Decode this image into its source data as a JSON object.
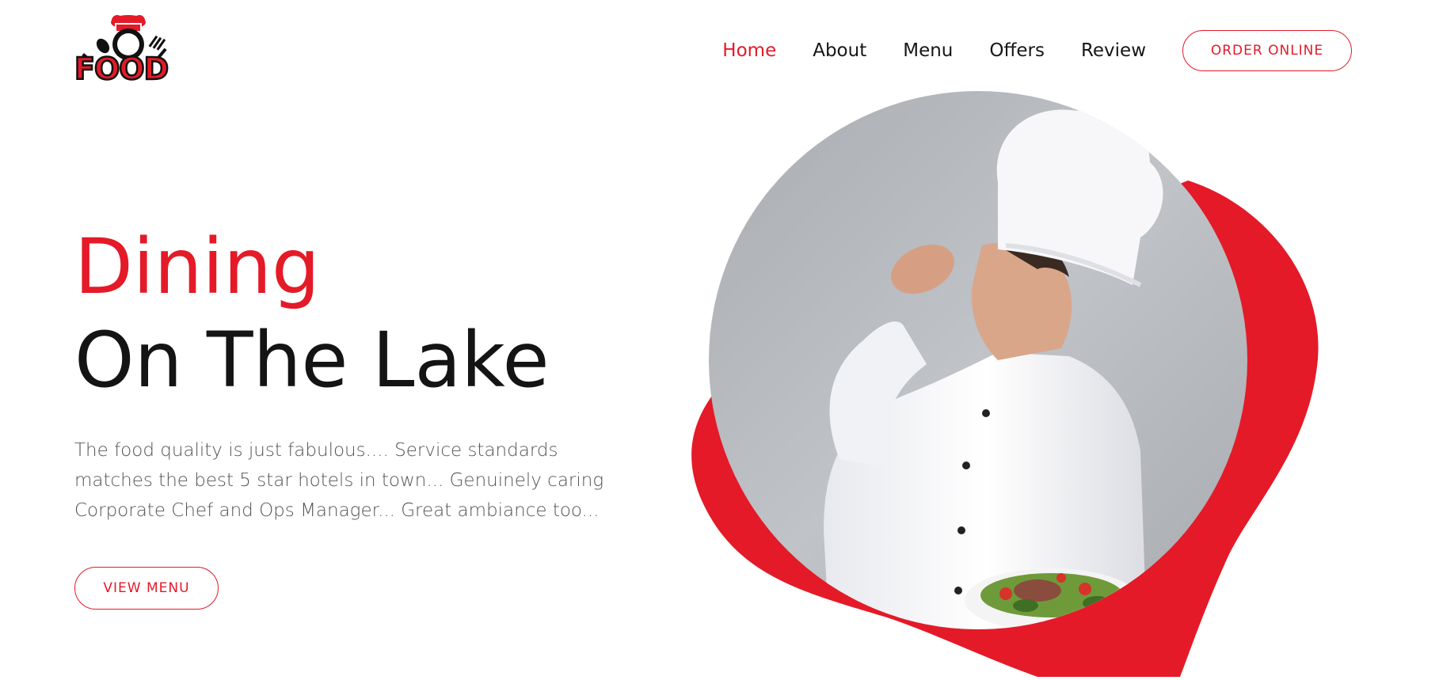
{
  "logo": {
    "text": "FOOD",
    "icon": "chef-hat-plate-fork-spoon-icon"
  },
  "nav": {
    "items": [
      {
        "label": "Home",
        "active": true
      },
      {
        "label": "About",
        "active": false
      },
      {
        "label": "Menu",
        "active": false
      },
      {
        "label": "Offers",
        "active": false
      },
      {
        "label": "Review",
        "active": false
      }
    ],
    "cta_label": "ORDER ONLINE"
  },
  "hero": {
    "title_line1": "Dining",
    "title_line2": "On The Lake",
    "description": "The food quality is just fabulous.... Service standards matches the best 5 star hotels in town... Genuinely caring Corporate Chef and Ops Manager... Great ambiance too...",
    "button_label": "VIEW MENU",
    "image": "chef-with-salad-plate-image"
  },
  "colors": {
    "accent": "#e41a28",
    "text": "#161616",
    "muted": "#555555",
    "image_bg": "#b9bcc0"
  }
}
